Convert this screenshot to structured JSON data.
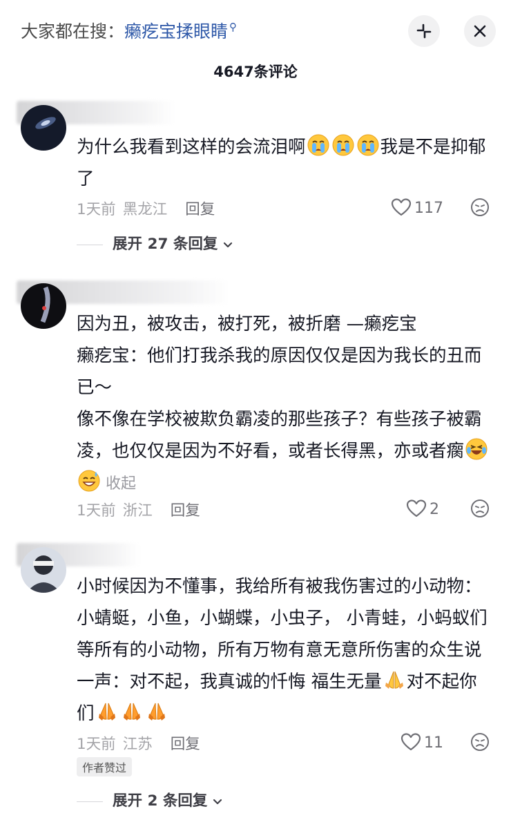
{
  "header": {
    "search_prefix": "大家都在搜：",
    "search_keyword": "癞疙宝揉眼睛",
    "search_icon": "magnifier-icon",
    "collapse_icon": "collapse-corners-icon",
    "close_icon": "close-icon"
  },
  "comment_count": "4647条评论",
  "comments": [
    {
      "text_a": "为什么我看到这样的会流泪啊",
      "emojis_a": [
        "crying-face-emoji",
        "crying-face-emoji",
        "crying-face-emoji"
      ],
      "text_b": "我是不是抑郁了",
      "time": "1天前",
      "location": "黑龙江",
      "reply": "回复",
      "likes": "117",
      "expand": "展开 27 条回复"
    },
    {
      "lines": [
        "因为丑，被攻击，被打死，被折磨 —癞疙宝",
        "癞疙宝：他们打我杀我的原因仅仅是因为我长的丑而已～",
        "像不像在学校被欺负霸凌的那些孩子？有些孩子被霸凌，也仅仅是因为不好看，或者长得黑，亦或者瘸"
      ],
      "emojis": [
        "tearful-laughing-emoji",
        "sweat-smile-emoji"
      ],
      "collapse": "收起",
      "time": "1天前",
      "location": "浙江",
      "reply": "回复",
      "likes": "2"
    },
    {
      "text_a": "小时候因为不懂事，我给所有被我伤害过的小动物：小蜻蜓，小鱼，小蝴蝶，小虫子， 小青蛙，小蚂蚁们等所有的小动物，所有万物有意无意所伤害的众生说一声：对不起，我真诚的忏悔 福生无量",
      "emoji_a": "praying-hands-emoji",
      "text_b": "对不起你们",
      "emojis_b": [
        "praying-hands-emoji",
        "praying-hands-emoji",
        "praying-hands-emoji"
      ],
      "time": "1天前",
      "location": "江苏",
      "reply": "回复",
      "likes": "11",
      "badge": "作者赞过",
      "expand": "展开 2 条回复"
    }
  ],
  "icons": {
    "like": "heart-outline-icon",
    "dislike": "frown-face-icon",
    "chevron": "chevron-down-icon"
  },
  "colors": {
    "keyword": "#2e58a8",
    "text": "#161823",
    "meta": "#a4a4a8",
    "emoji_yellow": "#ffc83d"
  }
}
